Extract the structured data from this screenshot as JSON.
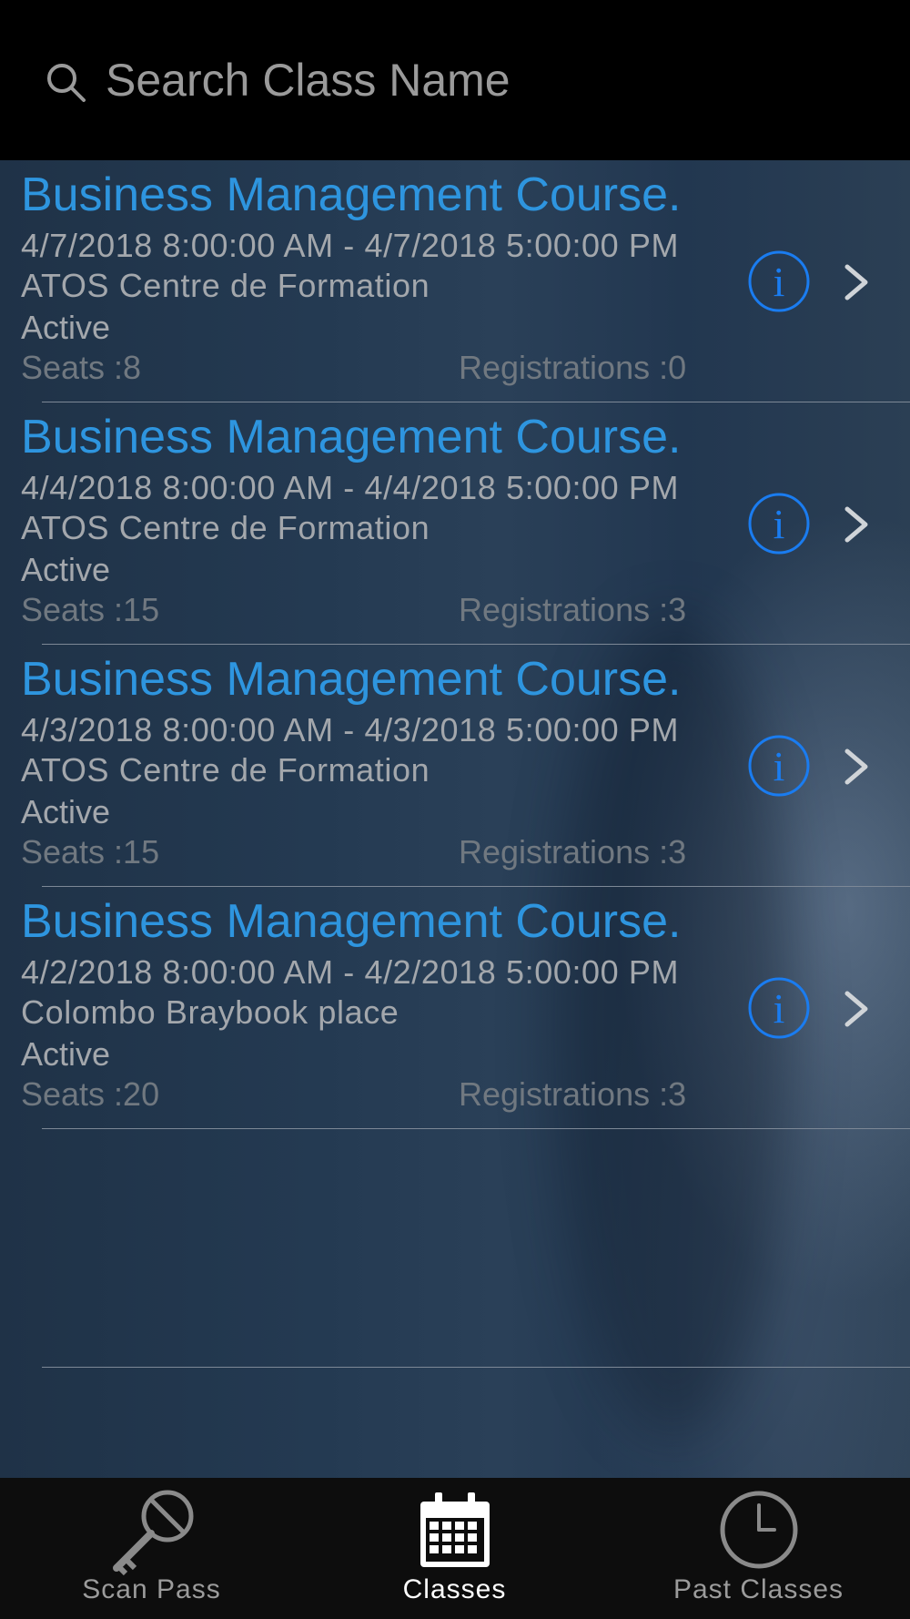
{
  "search": {
    "placeholder": "Search Class Name"
  },
  "classes": [
    {
      "title": "Business Management Course.",
      "dates": "4/7/2018 8:00:00 AM - 4/7/2018 5:00:00 PM",
      "location": "ATOS Centre de Formation",
      "status": "Active",
      "seats": "Seats :8",
      "registrations": "Registrations :0"
    },
    {
      "title": "Business Management Course.",
      "dates": "4/4/2018 8:00:00 AM - 4/4/2018 5:00:00 PM",
      "location": "ATOS Centre de Formation",
      "status": "Active",
      "seats": "Seats :15",
      "registrations": "Registrations :3"
    },
    {
      "title": "Business Management Course.",
      "dates": "4/3/2018 8:00:00 AM - 4/3/2018 5:00:00 PM",
      "location": "ATOS Centre de Formation",
      "status": "Active",
      "seats": "Seats :15",
      "registrations": "Registrations :3"
    },
    {
      "title": "Business Management Course.",
      "dates": "4/2/2018 8:00:00 AM - 4/2/2018 5:00:00 PM",
      "location": "Colombo Braybook place",
      "status": "Active",
      "seats": "Seats :20",
      "registrations": "Registrations :3"
    }
  ],
  "tabs": [
    {
      "label": "Scan Pass",
      "icon": "key-icon",
      "active": false
    },
    {
      "label": "Classes",
      "icon": "calendar-icon",
      "active": true
    },
    {
      "label": "Past Classes",
      "icon": "clock-icon",
      "active": false
    }
  ],
  "colors": {
    "accent": "#2e95df",
    "info_icon": "#1a7cf0",
    "header_bg": "#000000",
    "tab_bar_bg": "#0d0d0d"
  }
}
